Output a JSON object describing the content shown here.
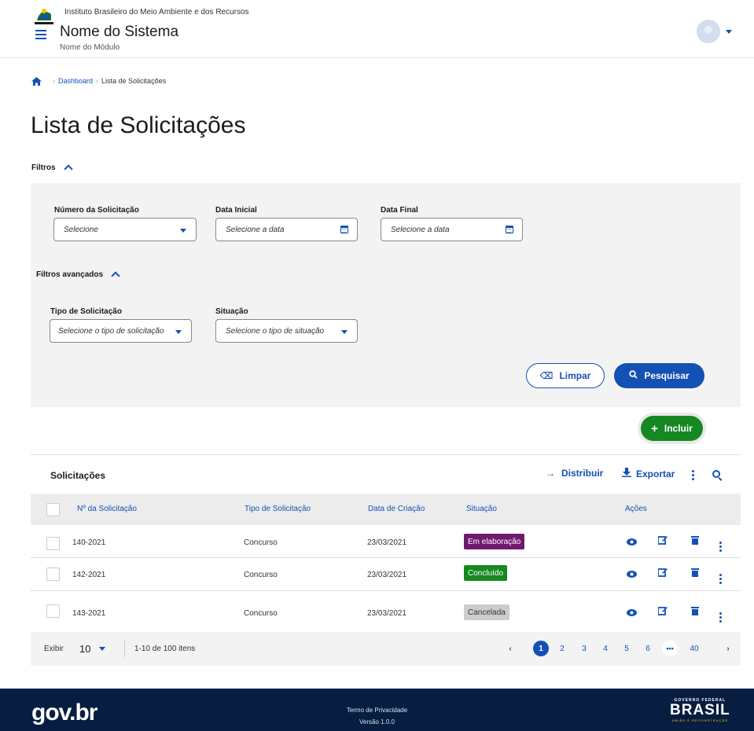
{
  "header": {
    "institution": "Instituto Brasileiro do Meio Ambiente e dos Recursos",
    "system_name": "Nome do Sistema",
    "module_name": "Nome do Módulo"
  },
  "breadcrumb": {
    "items": [
      "Dashboard",
      "Lista de Solicitações"
    ]
  },
  "page": {
    "title": "Lista de Solicitações"
  },
  "filters": {
    "toggle_label": "Filtros",
    "numero": {
      "label": "Número da Solicitação",
      "value": "Selecione"
    },
    "data_inicial": {
      "label": "Data Inicial",
      "value": "Selecione a data"
    },
    "data_final": {
      "label": "Data Final",
      "value": "Selecione a data"
    },
    "advanced_label": "Filtros avançados",
    "tipo": {
      "label": "Tipo de Solicitação",
      "value": "Selecione o tipo de solicitação"
    },
    "situacao": {
      "label": "Situação",
      "value": "Selecione o tipo de situação"
    },
    "clear_label": "Limpar",
    "search_label": "Pesquisar"
  },
  "include_label": "Incluir",
  "table": {
    "title": "Solicitações",
    "distribute_label": "Distribuir",
    "export_label": "Exportar",
    "columns": [
      "Nº da Solicitação",
      "Tipo de Solicitação",
      "Data de Criação",
      "Situação",
      "Ações"
    ],
    "rows": [
      {
        "numero": "140-2021",
        "tipo": "Concurso",
        "data": "23/03/2021",
        "situacao": "Em elaboração",
        "status_color": "#71196f"
      },
      {
        "numero": "142-2021",
        "tipo": "Concurso",
        "data": "23/03/2021",
        "situacao": "Concluído",
        "status_color": "#168821"
      },
      {
        "numero": "143-2021",
        "tipo": "Concurso",
        "data": "23/03/2021",
        "situacao": "Cancelada",
        "status_color": "#cccccc"
      }
    ]
  },
  "pagination": {
    "show_label": "Exibir",
    "per_page": "10",
    "range": "1-10 de 100 itens",
    "pages": [
      "1",
      "2",
      "3",
      "4",
      "5",
      "6",
      "40"
    ],
    "current": "1"
  },
  "footer": {
    "privacy": "Termo de Privacidade",
    "version": "Versão 1.0.0",
    "govbr": "gov.br",
    "brasil_top": "GOVERNO FEDERAL",
    "brasil_main": "BRASIL",
    "brasil_sub": "UNIÃO E RECONSTRUÇÃO"
  },
  "colors": {
    "primary": "#1351b4",
    "success": "#168821",
    "footer_bg": "#071d41"
  }
}
